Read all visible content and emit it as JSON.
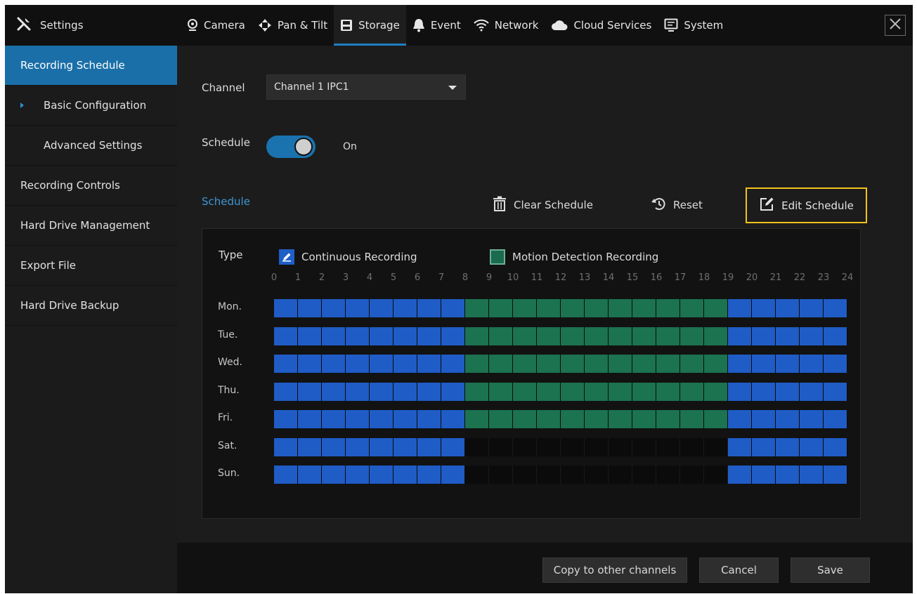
{
  "topbar": {
    "title": "Settings",
    "tabs": [
      {
        "label": "Camera",
        "icon": "camera-icon"
      },
      {
        "label": "Pan & Tilt",
        "icon": "pan-tilt-icon"
      },
      {
        "label": "Storage",
        "icon": "storage-icon",
        "active": true
      },
      {
        "label": "Event",
        "icon": "event-bell-icon"
      },
      {
        "label": "Network",
        "icon": "wifi-icon"
      },
      {
        "label": "Cloud Services",
        "icon": "cloud-icon"
      },
      {
        "label": "System",
        "icon": "system-monitor-icon"
      }
    ]
  },
  "sidebar": {
    "items": [
      {
        "label": "Recording Schedule",
        "active": true
      },
      {
        "label": "Basic Configuration",
        "sub": true,
        "current": true
      },
      {
        "label": "Advanced Settings",
        "sub": true
      },
      {
        "label": "Recording Controls"
      },
      {
        "label": "Hard Drive Management"
      },
      {
        "label": "Export File"
      },
      {
        "label": "Hard Drive Backup"
      }
    ]
  },
  "main": {
    "channel_label": "Channel",
    "channel_value": "Channel 1 IPC1",
    "schedule_label": "Schedule",
    "schedule_state": "On",
    "schedule_section": "Schedule",
    "clear_label": "Clear Schedule",
    "reset_label": "Reset",
    "edit_label": "Edit Schedule"
  },
  "panel": {
    "type_label": "Type",
    "legend_continuous": "Continuous Recording",
    "legend_motion": "Motion Detection Recording",
    "hours": [
      "0",
      "1",
      "2",
      "3",
      "4",
      "5",
      "6",
      "7",
      "8",
      "9",
      "10",
      "11",
      "12",
      "13",
      "14",
      "15",
      "16",
      "17",
      "18",
      "19",
      "20",
      "21",
      "22",
      "23",
      "24"
    ],
    "days": [
      {
        "label": "Mon.",
        "slots": "ccccccccmmmmmmmmmmmccccc"
      },
      {
        "label": "Tue.",
        "slots": "ccccccccmmmmmmmmmmmccccc"
      },
      {
        "label": "Wed.",
        "slots": "ccccccccmmmmmmmmmmmccccc"
      },
      {
        "label": "Thu.",
        "slots": "ccccccccmmmmmmmmmmmccccc"
      },
      {
        "label": "Fri.",
        "slots": "ccccccccmmmmmmmmmmmccccc"
      },
      {
        "label": "Sat.",
        "slots": "ccccccccnnnnnnnnnnnccccc"
      },
      {
        "label": "Sun.",
        "slots": "ccccccccnnnnnnnnnnnccccc"
      }
    ],
    "colors": {
      "continuous": "#1f5cc6",
      "motion": "#1b7350",
      "none": "#0b0b0b"
    }
  },
  "bottom": {
    "copy_label": "Copy to other channels",
    "cancel_label": "Cancel",
    "save_label": "Save"
  },
  "theme": {
    "accent": "#1a6fa8",
    "highlight": "#f2c21b"
  }
}
